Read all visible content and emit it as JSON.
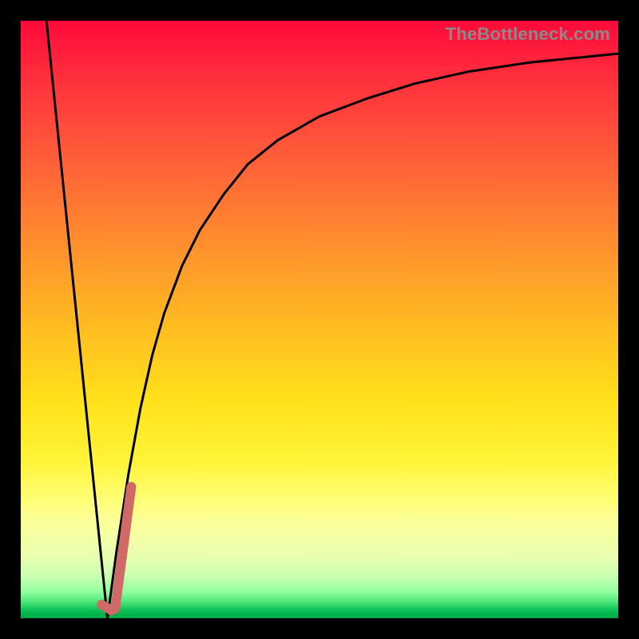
{
  "watermark": "TheBottleneck.com",
  "chart_data": {
    "type": "line",
    "title": "",
    "xlabel": "",
    "ylabel": "",
    "xlim": [
      0,
      100
    ],
    "ylim": [
      0,
      100
    ],
    "grid": false,
    "legend": false,
    "series": [
      {
        "name": "falling-line",
        "stroke": "#000000",
        "width": 3,
        "x": [
          4.3,
          14.5
        ],
        "values": [
          100,
          0
        ]
      },
      {
        "name": "rising-curve",
        "stroke": "#000000",
        "width": 3,
        "x": [
          14.5,
          16,
          18,
          20,
          22,
          24,
          27,
          30,
          34,
          38,
          43,
          50,
          58,
          66,
          75,
          85,
          95,
          100
        ],
        "values": [
          0,
          11,
          24,
          35,
          44,
          51,
          59,
          65,
          71,
          76,
          80,
          84,
          87,
          89.5,
          91.5,
          93,
          94,
          94.5
        ]
      },
      {
        "name": "tick-mark",
        "stroke": "#cf6a66",
        "width": 12,
        "linecap": "round",
        "x": [
          13.5,
          15.2,
          15.8,
          18.5
        ],
        "values": [
          2.3,
          1.3,
          1.6,
          22
        ]
      }
    ],
    "background_gradient": {
      "top": "#ff0a3a",
      "mid": "#ffe21a",
      "bottom": "#00a844"
    }
  }
}
